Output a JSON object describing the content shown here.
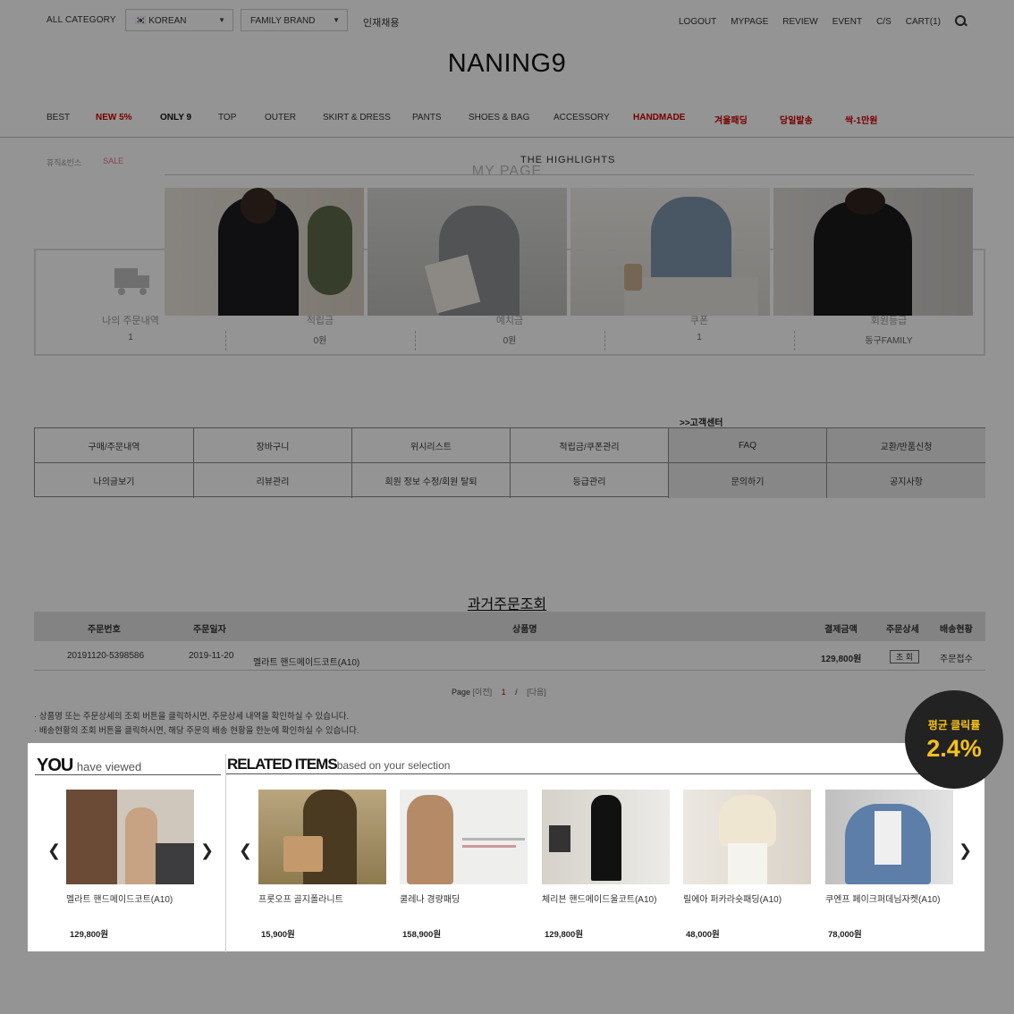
{
  "topbar": {
    "all_category": "ALL CATEGORY",
    "language": "🇰🇷 KOREAN",
    "family_brand": "FAMILY BRAND",
    "recruit": "인재채용",
    "links": [
      "LOGOUT",
      "MYPAGE",
      "REVIEW",
      "EVENT",
      "C/S",
      "CART(1)"
    ]
  },
  "logo": "NANING9",
  "nav": {
    "items": [
      "BEST",
      "NEW 5%",
      "ONLY 9",
      "TOP",
      "OUTER",
      "SKIRT & DRESS",
      "PANTS",
      "SHOES & BAG",
      "ACCESSORY",
      "HANDMADE",
      "겨울패딩",
      "당일발송",
      "싹-1만원"
    ],
    "sub_items": [
      "휴직&빈스",
      "SALE"
    ]
  },
  "highlights": {
    "title": "THE HIGHLIGHTS"
  },
  "mypage": {
    "title": "MY PAGE",
    "stats": [
      {
        "label": "나의 주문내역",
        "value": "1"
      },
      {
        "label": "적립금",
        "value": "0원"
      },
      {
        "label": "예치금",
        "value": "0원"
      },
      {
        "label": "쿠폰",
        "value": "1"
      },
      {
        "label": "회원등급",
        "value": "동구FAMILY"
      }
    ]
  },
  "links": {
    "customer_center": ">>고객센터",
    "row1": [
      "구매/주문내역",
      "장바구니",
      "위시리스트",
      "적립금/쿠폰관리",
      "FAQ",
      "교환/반품신청"
    ],
    "row2": [
      "나의글보기",
      "리뷰관리",
      "회원 정보 수정/회원 탈퇴",
      "등급관리",
      "문의하기",
      "공지사항"
    ]
  },
  "past_orders": {
    "title": "과거주문조회",
    "headers": [
      "주문번호",
      "주문일자",
      "상품명",
      "결제금액",
      "주문상세",
      "배송현황"
    ],
    "rows": [
      {
        "order_no": "20191120-5398586",
        "date": "2019-11-20",
        "product": "멜라트 핸드메이드코트(A10)",
        "amount": "129,800원",
        "detail_btn": "조 회",
        "status": "주문접수"
      }
    ],
    "paging": {
      "label": "Page",
      "prev": "[이전]",
      "current": "1",
      "slash": "/",
      "next": "[다음]"
    },
    "notes": [
      "상품명 또는 주문상세의 조회 버튼을 클릭하시면, 주문상세 내역을 확인하실 수 있습니다.",
      "배송현황의 조회 버튼을 클릭하시면, 해당 주문의 배송 현황을 한눈에 확인하실 수 있습니다."
    ]
  },
  "you_viewed": {
    "title_bold": "YOU",
    "title_light": "have viewed",
    "item": {
      "name": "멜라트 핸드메이드코트(A10)",
      "price": "129,800원"
    }
  },
  "related": {
    "title_bold": "RELATED ITEMS",
    "title_light": "based on your selection",
    "items": [
      {
        "name": "프롯오프 골지폴라니트",
        "price": "15,900원"
      },
      {
        "name": "쿨레나 경량패딩",
        "price": "158,900원"
      },
      {
        "name": "체리븐 핸드메이드울코트(A10)",
        "price": "129,800원"
      },
      {
        "name": "릴에아 퍼카라숏패딩(A10)",
        "price": "48,000원"
      },
      {
        "name": "쿠엔프 페이크퍼데님자켓(A10)",
        "price": "78,000원"
      }
    ]
  },
  "badge": {
    "label": "평균 클릭률",
    "value": "2.4%"
  },
  "colors": {
    "accent_red": "#cc0000",
    "badge_bg": "#222222",
    "badge_text": "#f6c21a"
  }
}
